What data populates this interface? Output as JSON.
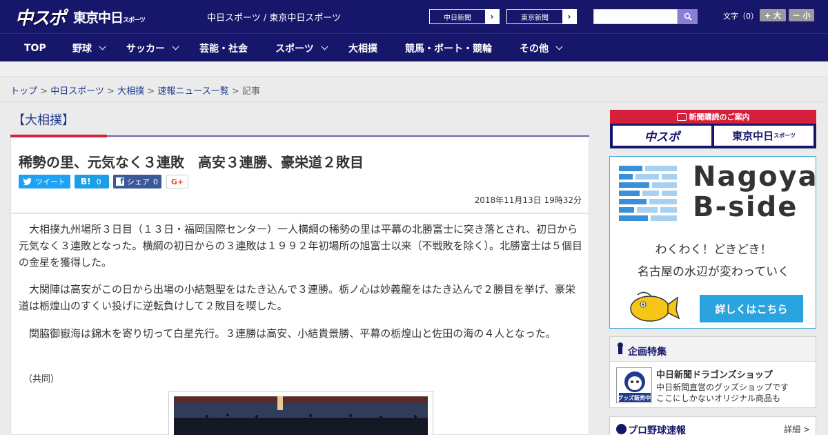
{
  "header": {
    "logo_main": "中スポ",
    "logo_tokyo": "東京中日",
    "logo_tokyo_small": "スポーツ",
    "site_names": "中日スポーツ / 東京中日スポーツ",
    "ext_links": [
      "中日新聞",
      "東京新聞"
    ],
    "font_label": "文字（0）",
    "font_bigger": "+ 大",
    "font_smaller": "－ 小",
    "brand_color": "#16166b"
  },
  "nav": {
    "items": [
      {
        "label": "TOP"
      },
      {
        "label": "野球"
      },
      {
        "label": "サッカー"
      },
      {
        "label": "芸能・社会"
      },
      {
        "label": "スポーツ"
      },
      {
        "label": "大相撲"
      },
      {
        "label": "競馬・ボート・競輪"
      },
      {
        "label": "その他"
      }
    ]
  },
  "breadcrumb": {
    "items": [
      "トップ",
      "中日スポーツ",
      "大相撲",
      "速報ニュース一覧"
    ],
    "separator": ">",
    "current": "記事"
  },
  "article": {
    "category": "【大相撲】",
    "headline": "稀勢の里、元気なく３連敗　高安３連勝、豪栄道２敗目",
    "share": {
      "tweet_label": "ツイート",
      "hatena_label": "B!",
      "hatena_count": "0",
      "fb_label": "シェア",
      "fb_count": "0",
      "gplus_label": "G+"
    },
    "date": "2018年11月13日 19時32分",
    "paragraphs": [
      "大相撲九州場所３日目（１３日・福岡国際センター）一人横綱の稀勢の里は平幕の北勝富士に突き落とされ、初日から元気なく３連敗となった。横綱の初日からの３連敗は１９９２年初場所の旭富士以来（不戦敗を除く）。北勝富士は５個目の金星を獲得した。",
      "大関陣は高安がこの日から出場の小結魁聖をはたき込んで３連勝。栃ノ心は妙義龍をはたき込んで２勝目を挙げ、豪栄道は栃煌山のすくい投げに逆転負けして２敗目を喫した。",
      "関脇御嶽海は錦木を寄り切って白星先行。３連勝は高安、小結貴景勝、平幕の栃煌山と佐田の海の４人となった。"
    ],
    "credit": "（共同）"
  },
  "sidebar": {
    "subscribe_title": "新聞購読のご案内",
    "subscribe_btn1": "中スポ",
    "subscribe_btn2": "東京中日",
    "subscribe_btn2_small": "スポーツ",
    "ad_title1": "Nagoya",
    "ad_title2": "B-side",
    "ad_text1": "わくわく！どきどき！",
    "ad_text2": "名古屋の水辺が変わっていく",
    "ad_button": "詳しくはこちら",
    "feature_head": "企画特集",
    "feature_thumb_label": "グッズ販売中",
    "feature_title": "中日新聞ドラゴンズショップ",
    "feature_desc1": "中日新聞直営のグッズショップです",
    "feature_desc2": "ここにしかないオリジナル商品も",
    "score_head": "プロ野球速報",
    "score_more": "詳細 >"
  }
}
